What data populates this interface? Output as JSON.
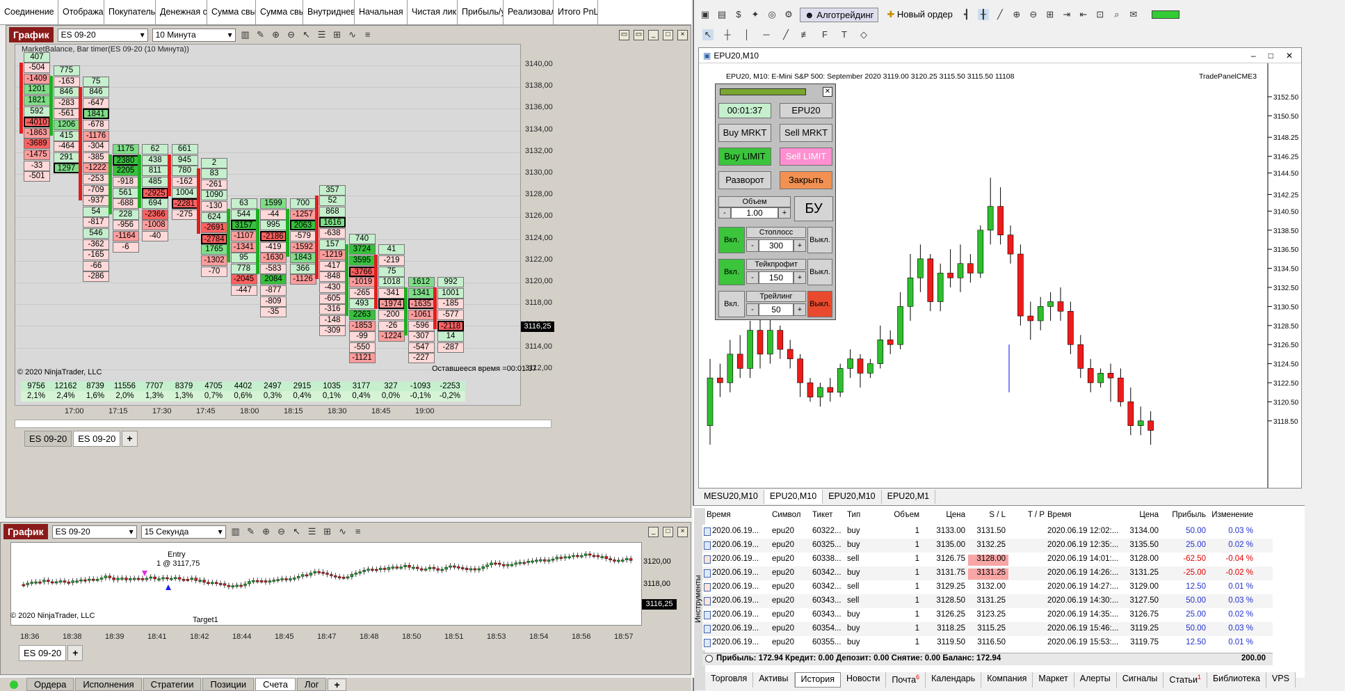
{
  "top_columns": [
    "Соединение",
    "Отображае",
    "Покупатель",
    "Денежная с",
    "Сумма свы",
    "Сумма свы",
    "Внутридневі",
    "Начальная",
    "Чистая ликв",
    "Прибыль/уб",
    "Реализовал",
    "Итого PnL"
  ],
  "chart1": {
    "badge": "График",
    "instrument": "ES 09-20",
    "interval": "10 Минута",
    "title": "MarketBalance, Bar timer(ES 09-20 (10 Минута))",
    "copyright": "© 2020 NinjaTrader, LLC",
    "timer": "Оставшееся время =00:01:37",
    "price_last": "3116,25",
    "yaxis": [
      "3140,00",
      "3138,00",
      "3136,00",
      "3134,00",
      "3132,00",
      "3130,00",
      "3128,00",
      "3126,00",
      "3124,00",
      "3122,00",
      "3120,00",
      "3118,00",
      "3116,00",
      "3114,00",
      "3112,00"
    ],
    "xaxis": [
      "17:00",
      "17:15",
      "17:30",
      "17:45",
      "18:00",
      "18:15",
      "18:30",
      "18:45",
      "19:00"
    ],
    "totals": [
      "9756",
      "12162",
      "8739",
      "11556",
      "7707",
      "8379",
      "4705",
      "4402",
      "2497",
      "2915",
      "1035",
      "3177",
      "327",
      "-1093",
      "-2253"
    ],
    "percents": [
      "2,1%",
      "2,4%",
      "1,6%",
      "2,0%",
      "1,3%",
      "1,3%",
      "0,7%",
      "0,6%",
      "0,3%",
      "0,4%",
      "0,1%",
      "0,4%",
      "0,0%",
      "-0,1%",
      "-0,2%"
    ],
    "columns": [
      [
        "407",
        "-504",
        "-1409",
        "1201",
        "1821",
        "592",
        "-4010",
        "-1863",
        "-3689",
        "-1475",
        "-33",
        "-501"
      ],
      [
        "775",
        "-163",
        "846",
        "-283",
        "-561",
        "1206",
        "415",
        "-464",
        "291",
        "1297"
      ],
      [
        "75",
        "846",
        "-647",
        "1841",
        "-678",
        "-1176",
        "-304",
        "-385",
        "-1222",
        "-253",
        "-709",
        "-937",
        "54",
        "-817",
        "546",
        "-362",
        "-165",
        "-66",
        "-286"
      ],
      [
        "1175",
        "2380",
        "2205",
        "-918",
        "561",
        "-688",
        "228",
        "-956",
        "-1164",
        "-6"
      ],
      [
        "62",
        "438",
        "811",
        "485",
        "-2925",
        "694",
        "-2366",
        "-1008",
        "-40"
      ],
      [
        "661",
        "945",
        "780",
        "-162",
        "1004",
        "-2281",
        "-275"
      ],
      [
        "2",
        "83",
        "-261",
        "1090",
        "-130",
        "624",
        "-2691",
        "-2784",
        "1765",
        "-1302",
        "-70"
      ],
      [
        "63",
        "544",
        "3157",
        "-1107",
        "-1341",
        "95",
        "778",
        "-2045",
        "-447"
      ],
      [
        "1599",
        "-44",
        "995",
        "-2186",
        "-419",
        "-1630",
        "-583",
        "2084",
        "-877",
        "-809",
        "-35"
      ],
      [
        "700",
        "-1257",
        "2063",
        "-579",
        "-1592",
        "1843",
        "366",
        "-1126"
      ],
      [
        "357",
        "52",
        "868",
        "1616",
        "-638",
        "157",
        "-1219",
        "-417",
        "-848",
        "-430",
        "-605",
        "-316",
        "-148",
        "-309"
      ],
      [
        "740",
        "3724",
        "3595",
        "-3766",
        "-1019",
        "-265",
        "493",
        "2263",
        "-1853",
        "-99",
        "-550",
        "-1121"
      ],
      [
        "41",
        "-219",
        "75",
        "1018",
        "-341",
        "-1974",
        "-200",
        "-26",
        "-1224"
      ],
      [
        "1612",
        "1341",
        "-1635",
        "-1061",
        "-596",
        "-307",
        "-547",
        "-227"
      ],
      [
        "992",
        "1001",
        "-185",
        "-577",
        "-2118",
        "14",
        "-287"
      ]
    ],
    "tabs": [
      "ES 09-20",
      "ES 09-20"
    ]
  },
  "chart2": {
    "badge": "График",
    "instrument": "ES 09-20",
    "interval": "15 Секунда",
    "copyright": "© 2020 NinjaTrader, LLC",
    "entry": "Entry",
    "entry_detail": "1 @ 3117,75",
    "target": "Target1",
    "price_last": "3116,25",
    "yaxis": [
      "3120,00",
      "3118,00"
    ],
    "xaxis": [
      "18:36",
      "18:38",
      "18:39",
      "18:41",
      "18:42",
      "18:44",
      "18:45",
      "18:47",
      "18:48",
      "18:50",
      "18:51",
      "18:53",
      "18:54",
      "18:56",
      "18:57"
    ],
    "tab": "ES 09-20"
  },
  "bottom_tabs": [
    "Ордера",
    "Исполнения",
    "Стратегии",
    "Позиции",
    "Счета",
    "Лог"
  ],
  "mt4": {
    "toolbar_algo": "Алготрейдинг",
    "toolbar_order": "Новый ордер",
    "window_title": "EPU20,M10",
    "info": "EPU20, M10:  E-Mini S&P 500: September 2020  3119.00 3120.25 3115.50 3115.50  11108",
    "trade_panel": "TradePanelCME3",
    "yaxis": [
      "3152.50",
      "3150.50",
      "3148.25",
      "3146.25",
      "3144.50",
      "3142.25",
      "3140.50",
      "3138.50",
      "3136.50",
      "3134.50",
      "3132.50",
      "3130.50",
      "3128.50",
      "3126.50",
      "3124.50",
      "3122.50",
      "3120.50",
      "3118.50"
    ],
    "panel": {
      "timer": "00:01:37",
      "symbol": "EPU20",
      "buy_mkt": "Buy MRKT",
      "sell_mkt": "Sell MRKT",
      "buy_lim": "Buy LIMIT",
      "sell_lim": "Sell LIMIT",
      "reverse": "Разворот",
      "close": "Закрыть",
      "vol_label": "Объем",
      "vol": "1.00",
      "be": "БУ",
      "on": "Вкл.",
      "off": "Выкл.",
      "sl_label": "Стоплосс",
      "sl": "300",
      "tp_label": "Тейкпрофит",
      "tp": "150",
      "tr_label": "Трейлинг",
      "tr": "50",
      "minus": "-",
      "plus": "+"
    },
    "chart_tabs": [
      "MESU20,M10",
      "EPU20,M10",
      "EPU20,M10",
      "EPU20,M1"
    ],
    "headers": [
      "Время",
      "Символ",
      "Тикет",
      "Тип",
      "Объем",
      "Цена",
      "S / L",
      "T / P",
      "Время",
      "Цена",
      "Прибыль",
      "Изменение"
    ],
    "rows": [
      [
        "2020.06.19...",
        "epu20",
        "60322...",
        "buy",
        "1",
        "3133.00",
        "3131.50",
        "",
        "2020.06.19 12:02:...",
        "3134.00",
        "50.00",
        "0.03 %"
      ],
      [
        "2020.06.19...",
        "epu20",
        "60325...",
        "buy",
        "1",
        "3135.00",
        "3132.25",
        "",
        "2020.06.19 12:35:...",
        "3135.50",
        "25.00",
        "0.02 %"
      ],
      [
        "2020.06.19...",
        "epu20",
        "60338...",
        "sell",
        "1",
        "3126.75",
        "3128.00",
        "",
        "2020.06.19 14:01:...",
        "3128.00",
        "-62.50",
        "-0.04 %"
      ],
      [
        "2020.06.19...",
        "epu20",
        "60342...",
        "buy",
        "1",
        "3131.75",
        "3131.25",
        "",
        "2020.06.19 14:26:...",
        "3131.25",
        "-25.00",
        "-0.02 %"
      ],
      [
        "2020.06.19...",
        "epu20",
        "60342...",
        "sell",
        "1",
        "3129.25",
        "3132.00",
        "",
        "2020.06.19 14:27:...",
        "3129.00",
        "12.50",
        "0.01 %"
      ],
      [
        "2020.06.19...",
        "epu20",
        "60343...",
        "sell",
        "1",
        "3128.50",
        "3131.25",
        "",
        "2020.06.19 14:30:...",
        "3127.50",
        "50.00",
        "0.03 %"
      ],
      [
        "2020.06.19...",
        "epu20",
        "60343...",
        "buy",
        "1",
        "3126.25",
        "3123.25",
        "",
        "2020.06.19 14:35:...",
        "3126.75",
        "25.00",
        "0.02 %"
      ],
      [
        "2020.06.19...",
        "epu20",
        "60354...",
        "buy",
        "1",
        "3118.25",
        "3115.25",
        "",
        "2020.06.19 15:46:...",
        "3119.25",
        "50.00",
        "0.03 %"
      ],
      [
        "2020.06.19...",
        "epu20",
        "60355...",
        "buy",
        "1",
        "3119.50",
        "3116.50",
        "",
        "2020.06.19 15:53:...",
        "3119.75",
        "12.50",
        "0.01 %"
      ]
    ],
    "summary": "Прибыль: 172.94  Кредит: 0.00  Депозит: 0.00  Снятие: 0.00  Баланс: 172.94",
    "summary_total": "200.00",
    "side_label": "Инструменты",
    "terminal_tabs": [
      "Торговля",
      "Активы",
      "История",
      "Новости",
      "Почта",
      "Календарь",
      "Компания",
      "Маркет",
      "Алерты",
      "Сигналы",
      "Статьи",
      "Библиотека",
      "VPS"
    ],
    "mail_badge": "6",
    "articles_badge": "1"
  }
}
